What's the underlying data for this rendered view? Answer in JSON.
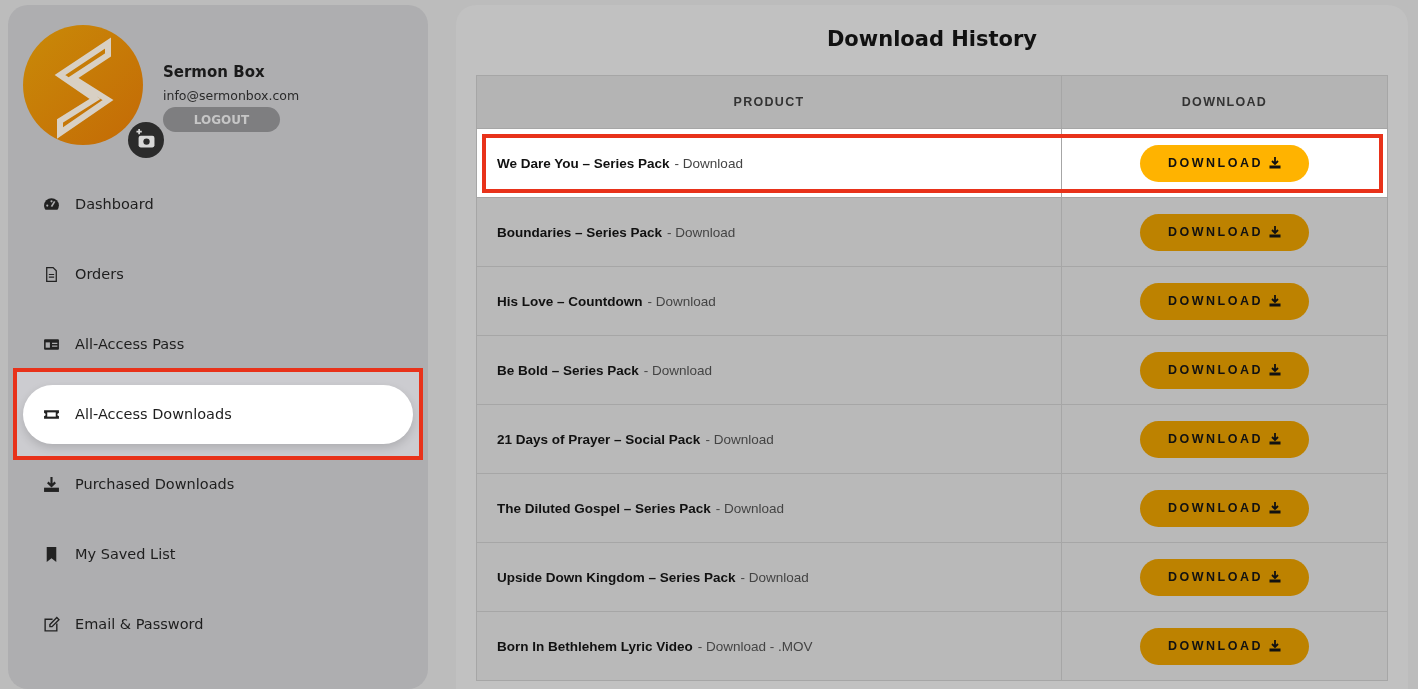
{
  "profile": {
    "name": "Sermon Box",
    "email": "info@sermonbox.com",
    "logout": "LOGOUT"
  },
  "sidebar": {
    "items": [
      {
        "kind": "gauge",
        "label": "Dashboard",
        "selected": false
      },
      {
        "kind": "document",
        "label": "Orders",
        "selected": false
      },
      {
        "kind": "card",
        "label": "All-Access Pass",
        "selected": false
      },
      {
        "kind": "ticket",
        "label": "All-Access Downloads",
        "selected": true
      },
      {
        "kind": "download",
        "label": "Purchased Downloads",
        "selected": false
      },
      {
        "kind": "bookmark",
        "label": "My Saved List",
        "selected": false
      },
      {
        "kind": "edit",
        "label": "Email & Password",
        "selected": false
      }
    ]
  },
  "main": {
    "title": "Download History",
    "table": {
      "columns": [
        "PRODUCT",
        "DOWNLOAD"
      ],
      "rows": [
        {
          "title": "We Dare You – Series Pack",
          "suffix": "- Download",
          "button": "DOWNLOAD",
          "highlighted": true
        },
        {
          "title": "Boundaries – Series Pack",
          "suffix": "- Download",
          "button": "DOWNLOAD",
          "highlighted": false
        },
        {
          "title": "His Love – Countdown",
          "suffix": "- Download",
          "button": "DOWNLOAD",
          "highlighted": false
        },
        {
          "title": "Be Bold – Series Pack",
          "suffix": "- Download",
          "button": "DOWNLOAD",
          "highlighted": false
        },
        {
          "title": "21 Days of Prayer – Social Pack",
          "suffix": "- Download",
          "button": "DOWNLOAD",
          "highlighted": false
        },
        {
          "title": "The Diluted Gospel – Series Pack",
          "suffix": "- Download",
          "button": "DOWNLOAD",
          "highlighted": false
        },
        {
          "title": "Upside Down Kingdom – Series Pack",
          "suffix": "- Download",
          "button": "DOWNLOAD",
          "highlighted": false
        },
        {
          "title": "Born In Bethlehem Lyric Video",
          "suffix": "- Download - .MOV",
          "button": "DOWNLOAD",
          "highlighted": false
        }
      ]
    }
  }
}
